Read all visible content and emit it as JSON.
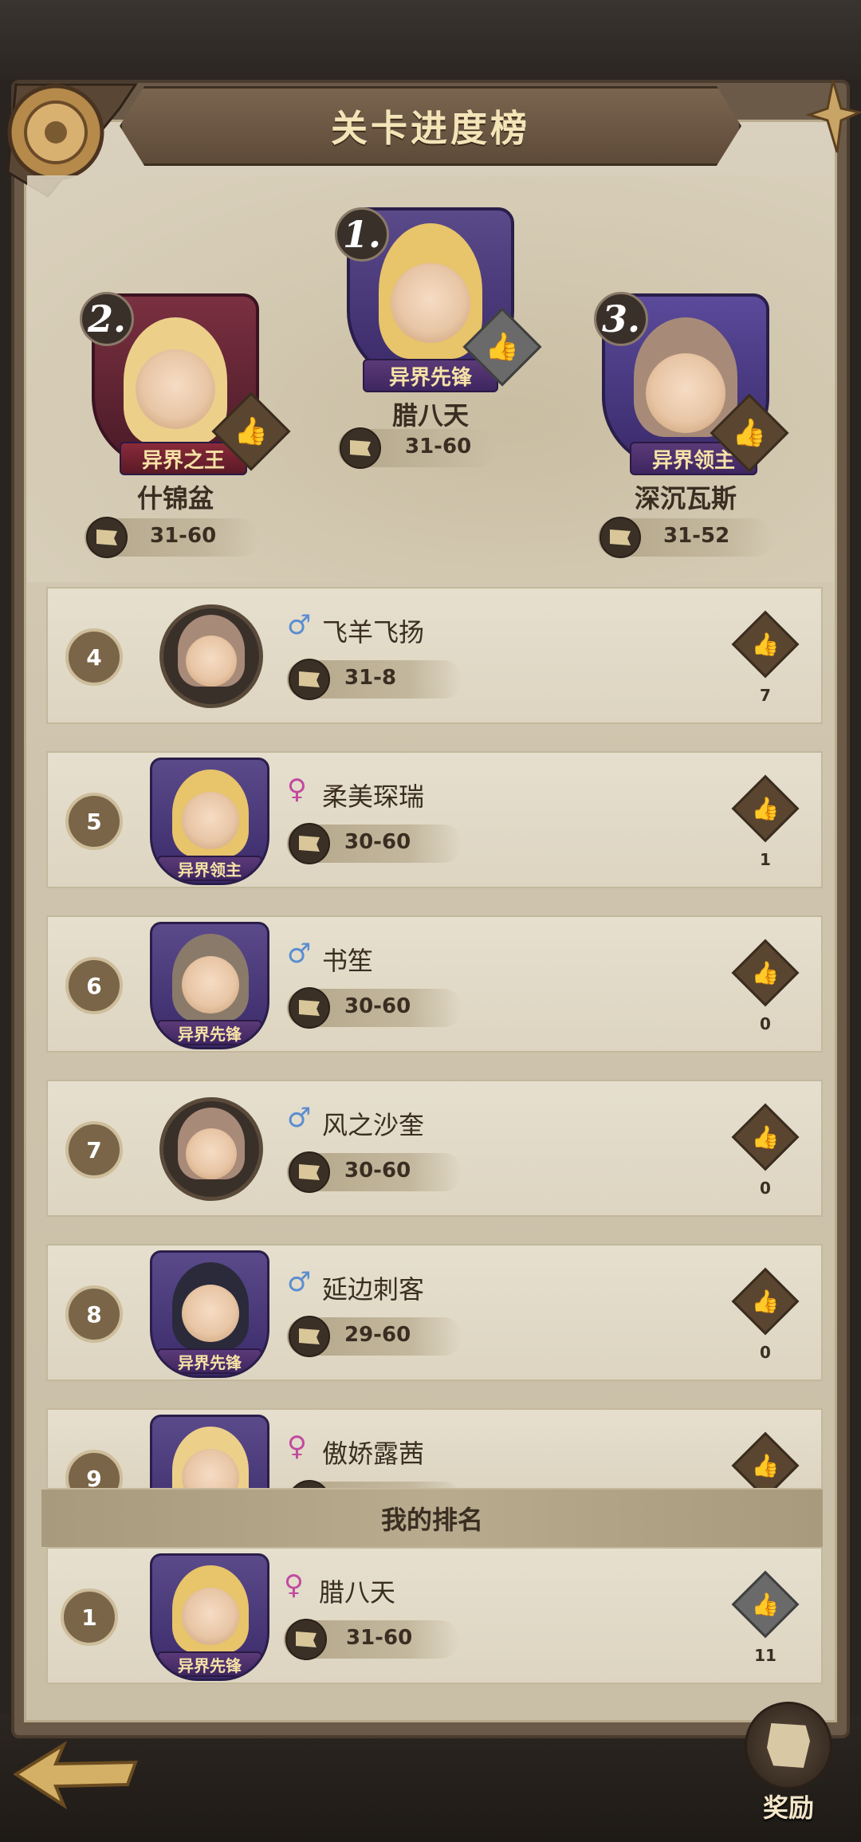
{
  "header": {
    "title": "关卡进度榜"
  },
  "podium": [
    {
      "rank": "1.",
      "title": "异界先锋",
      "name": "腊八天",
      "progress": "31-60",
      "frame_color": "#4a3a7a",
      "hair_color": "#e8c46a",
      "like_style": "gray"
    },
    {
      "rank": "2.",
      "title": "异界之王",
      "name": "什锦盆",
      "progress": "31-60",
      "frame_color": "#6a2a3a",
      "hair_color": "#ecd08a",
      "like_style": "brown"
    },
    {
      "rank": "3.",
      "title": "异界领主",
      "name": "深沉瓦斯",
      "progress": "31-52",
      "frame_color": "#4a3a8a",
      "hair_color": "#a88a78",
      "like_style": "brown"
    }
  ],
  "list": [
    {
      "rank": "4",
      "gender": "♂",
      "gender_type": "m",
      "name": "飞羊飞扬",
      "progress": "31-8",
      "likes": "7",
      "avatar_type": "circle",
      "frame_title": "",
      "hair_color": "#a88a78"
    },
    {
      "rank": "5",
      "gender": "♀",
      "gender_type": "f",
      "name": "柔美琛瑞",
      "progress": "30-60",
      "likes": "1",
      "avatar_type": "shield",
      "frame_title": "异界领主",
      "hair_color": "#e8c46a"
    },
    {
      "rank": "6",
      "gender": "♂",
      "gender_type": "m",
      "name": "书笙",
      "progress": "30-60",
      "likes": "0",
      "avatar_type": "shield",
      "frame_title": "异界先锋",
      "hair_color": "#8a7a6a"
    },
    {
      "rank": "7",
      "gender": "♂",
      "gender_type": "m",
      "name": "风之沙奎",
      "progress": "30-60",
      "likes": "0",
      "avatar_type": "circle",
      "frame_title": "",
      "hair_color": "#a88a78"
    },
    {
      "rank": "8",
      "gender": "♂",
      "gender_type": "m",
      "name": "延边刺客",
      "progress": "29-60",
      "likes": "0",
      "avatar_type": "shield",
      "frame_title": "异界先锋",
      "hair_color": "#2a2a3a"
    },
    {
      "rank": "9",
      "gender": "♀",
      "gender_type": "f",
      "name": "傲娇露茜",
      "progress": "",
      "likes": "",
      "avatar_type": "shield",
      "frame_title": "",
      "hair_color": "#ecd08a"
    }
  ],
  "my_rank": {
    "header": "我的排名",
    "rank": "1",
    "gender": "♀",
    "name": "腊八天",
    "progress": "31-60",
    "likes": "11",
    "frame_title": "异界先锋"
  },
  "footer": {
    "reward_label": "奖励"
  }
}
